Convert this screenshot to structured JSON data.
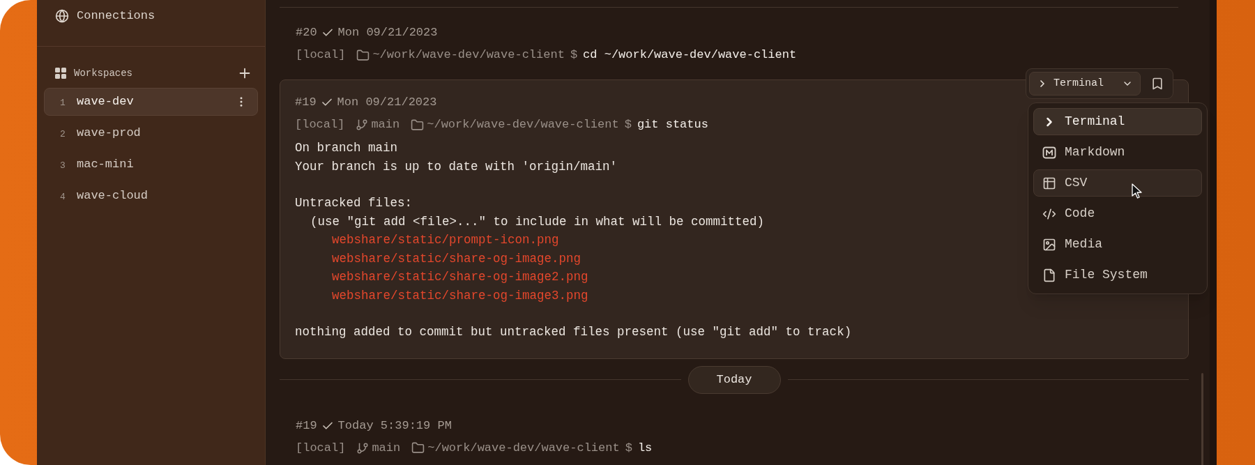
{
  "sidebar": {
    "connections": {
      "label": "Connections"
    },
    "workspaces": {
      "title": "Workspaces",
      "items": [
        {
          "number": "1",
          "name": "wave-dev",
          "selected": true
        },
        {
          "number": "2",
          "name": "wave-prod",
          "selected": false
        },
        {
          "number": "3",
          "name": "mac-mini",
          "selected": false
        },
        {
          "number": "4",
          "name": "wave-cloud",
          "selected": false
        }
      ]
    }
  },
  "history": [
    {
      "kind": "command",
      "number": "#20",
      "succeeded": true,
      "time": "Mon 09/21/2023",
      "host": "[local]",
      "cwd": "~/work/wave-dev/wave-client",
      "prompt_sign": "$",
      "command": "cd ~/work/wave-dev/wave-client",
      "selected": false
    },
    {
      "kind": "command",
      "number": "#19",
      "succeeded": true,
      "time": "Mon 09/21/2023",
      "host": "[local]",
      "branch": "main",
      "cwd": "~/work/wave-dev/wave-client",
      "prompt_sign": "$",
      "command": "git status",
      "selected": true,
      "output": [
        [
          {
            "kind": "text",
            "text": "On branch main"
          },
          {
            "kind": "text",
            "text": "Your branch is up to date with 'origin/main'"
          }
        ],
        [
          {
            "kind": "text",
            "text": "Untracked files:"
          },
          {
            "kind": "hint",
            "text": "(use \"git add <file>...\" to include in what will be committed)"
          },
          {
            "kind": "untracked",
            "text": "webshare/static/prompt-icon.png"
          },
          {
            "kind": "untracked",
            "text": "webshare/static/share-og-image.png"
          },
          {
            "kind": "untracked",
            "text": "webshare/static/share-og-image2.png"
          },
          {
            "kind": "untracked",
            "text": "webshare/static/share-og-image3.png"
          }
        ],
        [
          {
            "kind": "text",
            "text": "nothing added to commit but untracked files present (use \"git add\" to track)"
          }
        ]
      ]
    },
    {
      "kind": "divider",
      "label": "Today"
    },
    {
      "kind": "command",
      "number": "#19",
      "succeeded": true,
      "time": "Today 5:39:19 PM",
      "host": "[local]",
      "branch": "main",
      "cwd": "~/work/wave-dev/wave-client",
      "prompt_sign": "$",
      "command": "ls",
      "selected": false
    }
  ],
  "view_selector": {
    "label": "Terminal"
  },
  "view_menu": [
    {
      "kind": "terminal",
      "label": "Terminal",
      "selected": true,
      "hovered": false
    },
    {
      "kind": "markdown",
      "label": "Markdown",
      "selected": false,
      "hovered": false
    },
    {
      "kind": "csv",
      "label": "CSV",
      "selected": false,
      "hovered": true
    },
    {
      "kind": "code",
      "label": "Code",
      "selected": false,
      "hovered": false
    },
    {
      "kind": "media",
      "label": "Media",
      "selected": false,
      "hovered": false
    },
    {
      "kind": "file",
      "label": "File System",
      "selected": false,
      "hovered": false
    }
  ]
}
